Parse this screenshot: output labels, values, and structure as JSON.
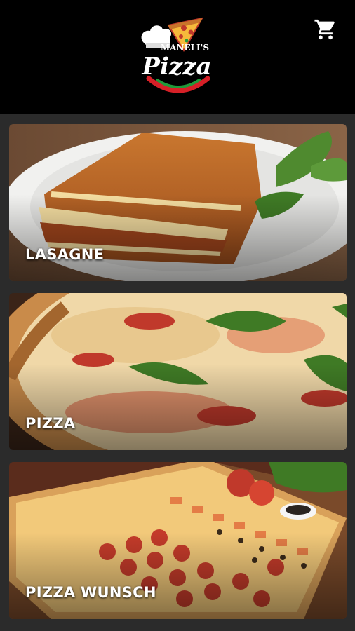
{
  "header": {
    "logo": {
      "brand_top": "MANELI'S",
      "brand_main": "Pizza"
    },
    "cart_icon": "shopping-cart-icon"
  },
  "categories": [
    {
      "label": "LASAGNE"
    },
    {
      "label": "PIZZA"
    },
    {
      "label": "PIZZA WUNSCH"
    }
  ],
  "colors": {
    "header_bg": "#000000",
    "page_bg": "#2b2b2b",
    "label_text": "#ffffff",
    "logo_green": "#1f9a3a",
    "logo_red": "#d62027"
  }
}
